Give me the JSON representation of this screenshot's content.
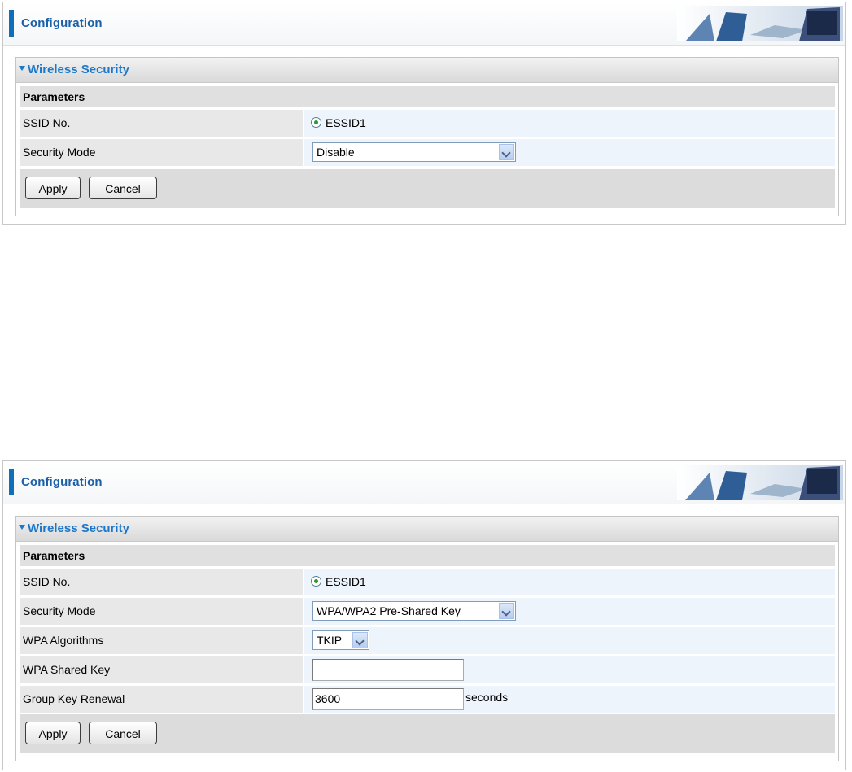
{
  "panels": [
    {
      "header_title": "Configuration",
      "section_title": "Wireless Security",
      "params_heading": "Parameters",
      "ssid_label": "SSID No.",
      "ssid_value": "ESSID1",
      "security_mode_label": "Security Mode",
      "security_mode_value": "Disable",
      "apply_label": "Apply",
      "cancel_label": "Cancel"
    },
    {
      "header_title": "Configuration",
      "section_title": "Wireless Security",
      "params_heading": "Parameters",
      "ssid_label": "SSID No.",
      "ssid_value": "ESSID1",
      "security_mode_label": "Security Mode",
      "security_mode_value": "WPA/WPA2 Pre-Shared Key",
      "wpa_algorithms_label": "WPA Algorithms",
      "wpa_algorithms_value": "TKIP",
      "wpa_shared_key_label": "WPA Shared Key",
      "wpa_shared_key_value": "",
      "group_key_label": "Group Key Renewal",
      "group_key_value": "3600",
      "group_key_unit": "seconds",
      "apply_label": "Apply",
      "cancel_label": "Cancel"
    }
  ],
  "colors": {
    "accent_bar": "#0f6fb8",
    "title_text": "#1a5fa8",
    "section_text": "#1c78c8",
    "radio_selected": "#2a9a2a"
  }
}
